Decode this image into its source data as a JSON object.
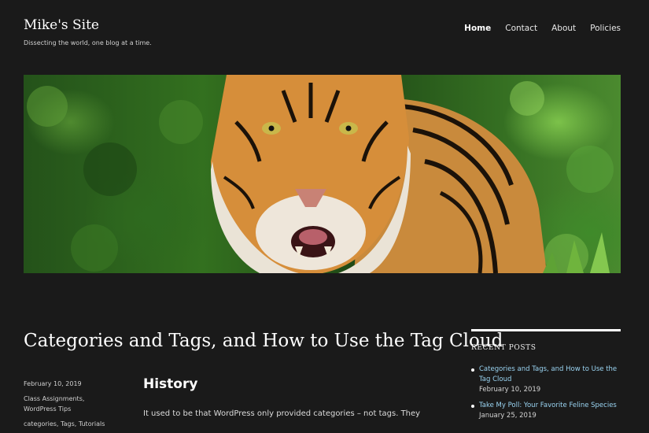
{
  "site": {
    "title": "Mike's Site",
    "tagline": "Dissecting the world, one blog at a time."
  },
  "nav": {
    "items": [
      {
        "label": "Home",
        "active": true
      },
      {
        "label": "Contact"
      },
      {
        "label": "About"
      },
      {
        "label": "Policies"
      }
    ]
  },
  "hero": {
    "subject": "tiger-photo"
  },
  "post": {
    "title": "Categories and Tags, and How to Use the Tag Cloud",
    "date": "February 10, 2019",
    "categories_line1": "Class Assignments,",
    "categories_line2": "WordPress Tips",
    "tags": "categories, Tags, Tutorials",
    "heading": "History",
    "paragraph": "It used to be that WordPress only provided categories – not tags.  They"
  },
  "sidebar": {
    "widget_title": "RECENT POSTS",
    "recent_posts": [
      {
        "title": "Categories and Tags, and How to Use the Tag Cloud",
        "date": "February 10, 2019"
      },
      {
        "title": "Take My Poll: Your Favorite Feline Species",
        "date": "January 25, 2019"
      }
    ]
  },
  "colors": {
    "background": "#1a1a1a",
    "link": "#9ad4f2",
    "text": "#e5e5e5"
  }
}
